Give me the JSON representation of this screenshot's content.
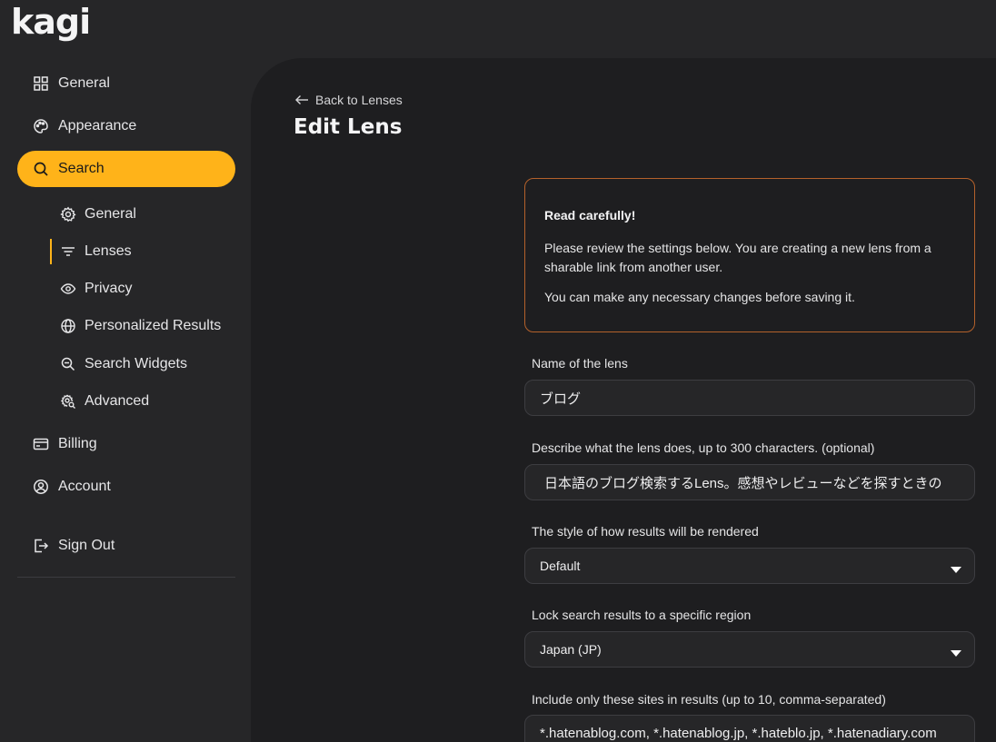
{
  "brand": {
    "logo_text": "kagi",
    "accent": "#ffb319"
  },
  "sidebar": {
    "items": [
      {
        "label": "General",
        "icon": "grid-icon"
      },
      {
        "label": "Appearance",
        "icon": "palette-icon"
      },
      {
        "label": "Search",
        "icon": "search-icon",
        "active": true
      },
      {
        "label": "Billing",
        "icon": "credit-card-icon"
      },
      {
        "label": "Account",
        "icon": "user-circle-icon"
      }
    ],
    "search_subitems": [
      {
        "label": "General",
        "icon": "gear-icon"
      },
      {
        "label": "Lenses",
        "icon": "filter-icon",
        "current": true
      },
      {
        "label": "Privacy",
        "icon": "eye-icon"
      },
      {
        "label": "Personalized Results",
        "icon": "globe-icon"
      },
      {
        "label": "Search Widgets",
        "icon": "magnifier-icon"
      },
      {
        "label": "Advanced",
        "icon": "gear-search-icon"
      }
    ],
    "sign_out": {
      "label": "Sign Out",
      "icon": "sign-out-icon"
    }
  },
  "main": {
    "back_link": "Back to Lenses",
    "title": "Edit Lens",
    "notice": {
      "heading": "Read carefully!",
      "body_1": "Please review the settings below. You are creating a new lens from a sharable link from another user.",
      "body_2": "You can make any necessary changes before saving it.",
      "border_color": "#b4612b"
    },
    "form": {
      "name_label": "Name of the lens",
      "name_value": "ブログ",
      "description_label": "Describe what the lens does, up to 300 characters. (optional)",
      "description_value": "日本語のブログ検索するLens。感想やレビューなどを探すときの",
      "style_label": "The style of how results will be rendered",
      "style_value": "Default",
      "region_label": "Lock search results to a specific region",
      "region_value": "Japan (JP)",
      "sites_label": "Include only these sites in results (up to 10, comma-separated)",
      "sites_value": "*.hatenablog.com, *.hatenablog.jp, *.hateblo.jp, *.hatenadiary.com"
    }
  }
}
